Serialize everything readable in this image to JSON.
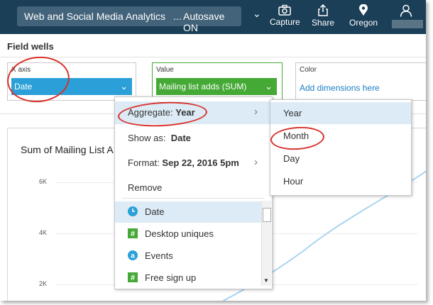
{
  "header": {
    "title": "Web and Social Media Analytics",
    "ellipsis": "...",
    "autosave": "Autosave ON",
    "chevron": "⌄",
    "buttons": [
      {
        "label": "Capture",
        "icon": "camera-icon"
      },
      {
        "label": "Share",
        "icon": "share-icon"
      },
      {
        "label": "Oregon",
        "icon": "location-pin-icon"
      }
    ],
    "user_icon": "user-icon"
  },
  "field_wells": {
    "title": "Field wells",
    "x_axis": {
      "label": "X axis",
      "value": "Date",
      "color": "#2ba0d8"
    },
    "value": {
      "label": "Value",
      "value": "Mailing list adds (SUM)",
      "color": "#44a935"
    },
    "color": {
      "label": "Color",
      "placeholder": "Add dimensions here"
    }
  },
  "chart": {
    "title": "Sum of Mailing List A",
    "y_ticks": [
      "6K",
      "4K",
      "2K"
    ]
  },
  "context_menu": {
    "aggregate_label": "Aggregate:",
    "aggregate_value": "Year",
    "show_as_label": "Show as:",
    "show_as_value": "Date",
    "format_label": "Format:",
    "format_value": "Sep 22, 2016 5pm",
    "remove": "Remove",
    "chevron": "›",
    "fields": [
      {
        "label": "Date",
        "icon": "date-clock-icon",
        "selected": true
      },
      {
        "label": "Desktop uniques",
        "icon": "hash-number-icon",
        "selected": false
      },
      {
        "label": "Events",
        "icon": "text-a-icon",
        "selected": false
      },
      {
        "label": "Free sign up",
        "icon": "hash-number-icon",
        "selected": false
      }
    ]
  },
  "aggregate_submenu": {
    "items": [
      "Year",
      "Month",
      "Day",
      "Hour"
    ],
    "selected": "Year"
  },
  "colors": {
    "header_bg": "#1b3f57",
    "highlight_red": "#d9312b",
    "menu_hover": "#dcebf5",
    "accent_blue": "#2ba0d8",
    "accent_green": "#44a935"
  }
}
